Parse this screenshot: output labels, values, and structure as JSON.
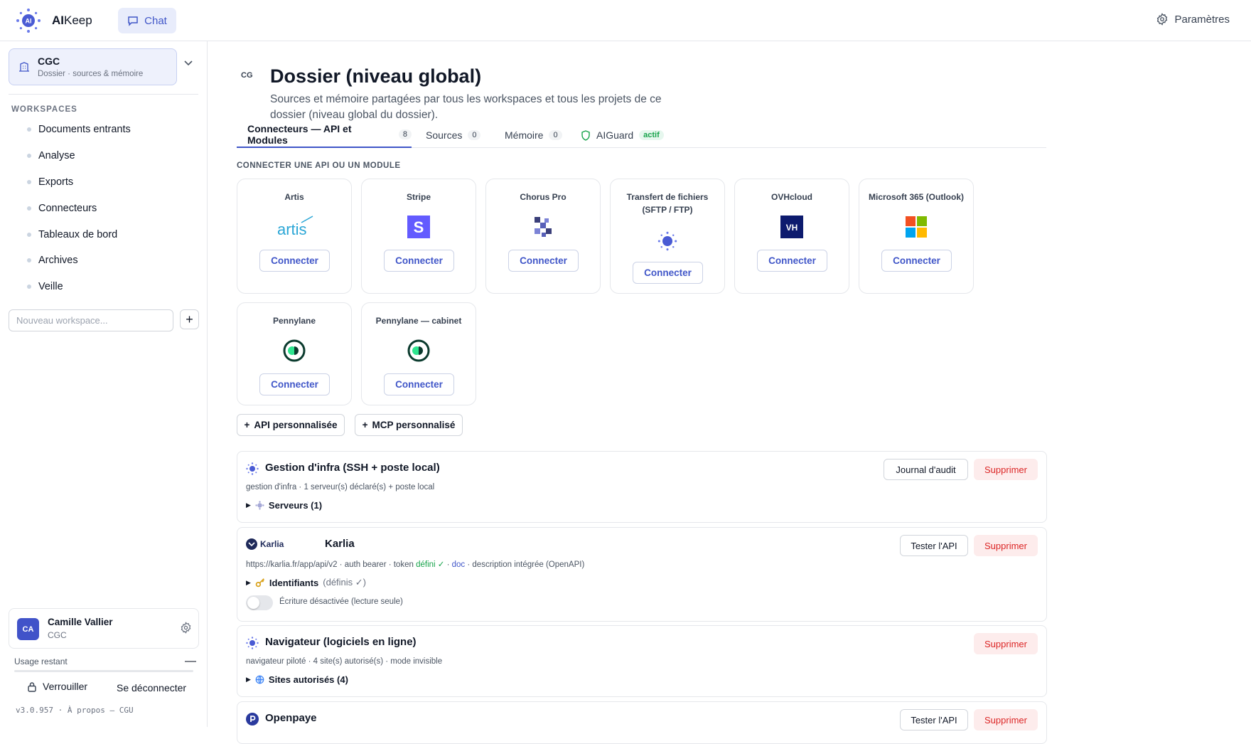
{
  "app": {
    "brand_bold": "AI",
    "brand_light": "Keep",
    "chat_label": "Chat",
    "settings_label": "Paramètres",
    "colors": {
      "accent": "#4056c8",
      "danger": "#dc2626",
      "success": "#16a34a"
    }
  },
  "sidebar": {
    "org": {
      "name": "CGC",
      "subtitle": "Dossier · sources & mémoire"
    },
    "workspaces_title": "WORKSPACES",
    "workspaces": [
      {
        "label": "Documents entrants"
      },
      {
        "label": "Analyse"
      },
      {
        "label": "Exports"
      },
      {
        "label": "Connecteurs"
      },
      {
        "label": "Tableaux de bord"
      },
      {
        "label": "Archives"
      },
      {
        "label": "Veille"
      }
    ],
    "new_workspace_placeholder": "Nouveau workspace...",
    "add_symbol": "+",
    "user": {
      "initials": "CA",
      "name": "Camille Vallier",
      "org": "CGC"
    },
    "usage_label": "Usage restant",
    "usage_toggle": "—",
    "lock_label": "Verrouiller",
    "logout_label": "Se déconnecter",
    "version": "v3.0.957 · À propos — CGU"
  },
  "main": {
    "badge": "CG",
    "title": "Dossier (niveau global)",
    "description": "Sources et mémoire partagées par tous les workspaces et tous les projets de ce dossier (niveau global du dossier).",
    "tabs": [
      {
        "label": "Connecteurs — API et Modules",
        "count": "8"
      },
      {
        "label": "Sources",
        "count": "0"
      },
      {
        "label": "Mémoire",
        "count": "0"
      },
      {
        "label": "AIGuard",
        "status": "actif"
      }
    ],
    "connect_section_title": "CONNECTER UNE API OU UN MODULE",
    "connect_label": "Connecter",
    "connectors": [
      {
        "name": "Artis",
        "logo": "artis-logo"
      },
      {
        "name": "Stripe",
        "logo": "stripe-logo"
      },
      {
        "name": "Chorus Pro",
        "logo": "chorus-logo"
      },
      {
        "name": "Transfert de fichiers (SFTP / FTP)",
        "logo": "aikeep-logo"
      },
      {
        "name": "OVHcloud",
        "logo": "ovh-logo"
      },
      {
        "name": "Microsoft 365 (Outlook)",
        "logo": "microsoft-logo"
      },
      {
        "name": "Pennylane",
        "logo": "pennylane-logo"
      },
      {
        "name": "Pennylane — cabinet",
        "logo": "pennylane-logo"
      }
    ],
    "artis_wordmark": "artis",
    "stripe_letter": "S",
    "ovh_letters": "VH",
    "custom_api_label": "API personnalisée",
    "custom_mcp_label": "MCP personnalisé",
    "plus": "+",
    "panels": {
      "infra": {
        "title": "Gestion d'infra (SSH + poste local)",
        "meta": "gestion d'infra · 1 serveur(s) déclaré(s) + poste local",
        "expander": "Serveurs (1)",
        "audit_label": "Journal d'audit",
        "delete_label": "Supprimer"
      },
      "karlia": {
        "logo_text": "Karlia",
        "title": "Karlia",
        "meta_prefix": "https://karlia.fr/app/api/v2 · auth bearer · token ",
        "meta_ok": "défini ✓",
        "meta_sep": " · ",
        "meta_link": "doc",
        "meta_suffix": " · description intégrée (OpenAPI)",
        "expander": "Identifiants",
        "expander_note": "(définis ✓)",
        "toggle_label": "Écriture désactivée (lecture seule)",
        "test_label": "Tester l'API",
        "delete_label": "Supprimer"
      },
      "browser": {
        "title": "Navigateur (logiciels en ligne)",
        "meta": "navigateur piloté · 4 site(s) autorisé(s) · mode invisible",
        "expander": "Sites autorisés (4)",
        "delete_label": "Supprimer"
      },
      "openpaye": {
        "title": "Openpaye",
        "test_label": "Tester l'API",
        "delete_label": "Supprimer"
      }
    }
  }
}
